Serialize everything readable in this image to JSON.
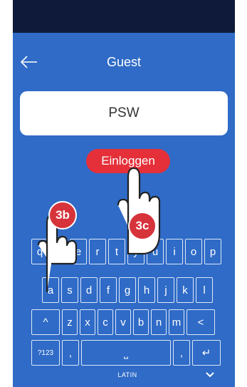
{
  "header": {
    "title": "Guest"
  },
  "form": {
    "password_value": "PSW",
    "login_label": "Einloggen"
  },
  "keyboard": {
    "row1": [
      "q",
      "w",
      "e",
      "r",
      "t",
      "y",
      "u",
      "i",
      "o",
      "p"
    ],
    "row2": [
      "a",
      "s",
      "d",
      "f",
      "g",
      "h",
      "j",
      "k",
      "l"
    ],
    "row3": {
      "shift": "^",
      "letters": [
        "z",
        "x",
        "c",
        "v",
        "b",
        "n",
        "m"
      ],
      "backspace": "<"
    },
    "row4": {
      "numbers": "?123",
      "comma": ",",
      "space": "⎵",
      "period": ",",
      "enter": "↵"
    },
    "language": "LATIN"
  },
  "annotations": {
    "step_b": "3b",
    "step_c": "3c"
  },
  "colors": {
    "background": "#2f6bc7",
    "status_bar": "#0f1a3a",
    "accent_red": "#e5303a",
    "badge_red": "#d6333b"
  },
  "icons": {
    "back": "arrow-left-icon",
    "hide_keyboard": "chevron-down-icon",
    "hand": "pointing-hand-icon"
  }
}
